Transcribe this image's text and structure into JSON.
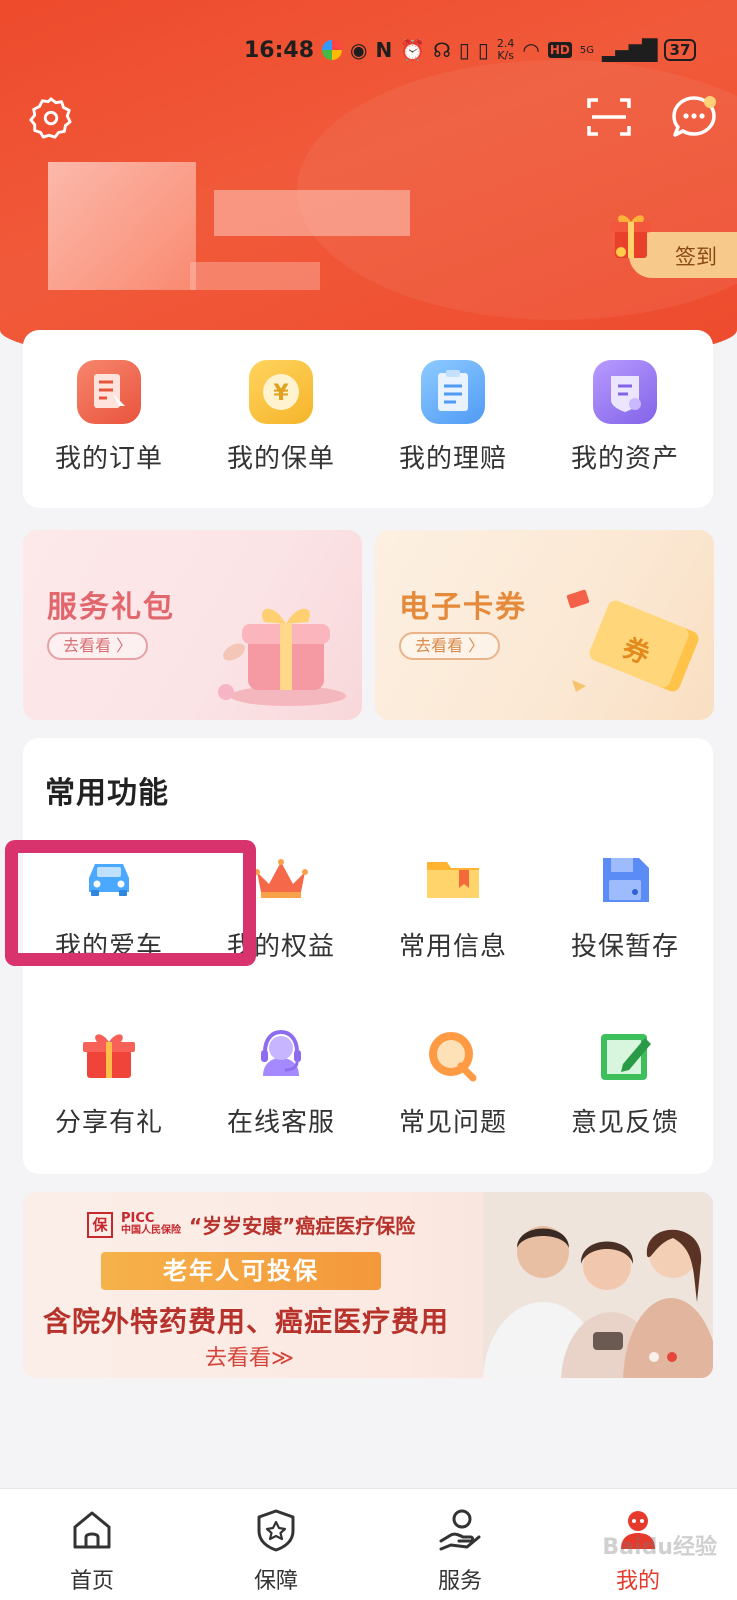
{
  "status_bar": {
    "time": "16:48",
    "net_speed_value": "2.4",
    "net_speed_unit": "K/s",
    "hd": "HD",
    "signal_label": "5G",
    "battery": "37"
  },
  "header": {
    "checkin_label": "签到"
  },
  "quick_actions": [
    {
      "label": "我的订单",
      "icon": "order-icon"
    },
    {
      "label": "我的保单",
      "icon": "policy-icon"
    },
    {
      "label": "我的理赔",
      "icon": "claim-icon"
    },
    {
      "label": "我的资产",
      "icon": "asset-icon"
    }
  ],
  "promos": {
    "gift": {
      "title": "服务礼包",
      "button": "去看看 〉"
    },
    "coupon": {
      "title": "电子卡券",
      "button": "去看看 〉",
      "stamp": "券"
    }
  },
  "functions": {
    "title": "常用功能",
    "items": [
      {
        "label": "我的爱车",
        "icon": "car-icon"
      },
      {
        "label": "我的权益",
        "icon": "crown-icon"
      },
      {
        "label": "常用信息",
        "icon": "folder-icon"
      },
      {
        "label": "投保暂存",
        "icon": "save-icon"
      },
      {
        "label": "分享有礼",
        "icon": "gift-icon"
      },
      {
        "label": "在线客服",
        "icon": "headset-icon"
      },
      {
        "label": "常见问题",
        "icon": "question-icon"
      },
      {
        "label": "意见反馈",
        "icon": "feedback-icon"
      }
    ]
  },
  "banner": {
    "logo_mark": "保",
    "logo_line1": "PICC",
    "logo_line2": "中国人民保险",
    "product": "“岁岁安康”癌症医疗保险",
    "ribbon": "老年人可投保",
    "headline": "含院外特药费用、癌症医疗费用",
    "cta": "去看看≫"
  },
  "tabbar": {
    "items": [
      {
        "label": "首页",
        "icon": "home-icon",
        "active": false
      },
      {
        "label": "保障",
        "icon": "shield-icon",
        "active": false
      },
      {
        "label": "服务",
        "icon": "service-icon",
        "active": false
      },
      {
        "label": "我的",
        "icon": "profile-icon",
        "active": true
      }
    ],
    "watermark": "Baidu经验"
  },
  "colors": {
    "brand_red": "#ee4a2c",
    "highlight_box": "#d8336c",
    "active_tab": "#e63a2c"
  }
}
